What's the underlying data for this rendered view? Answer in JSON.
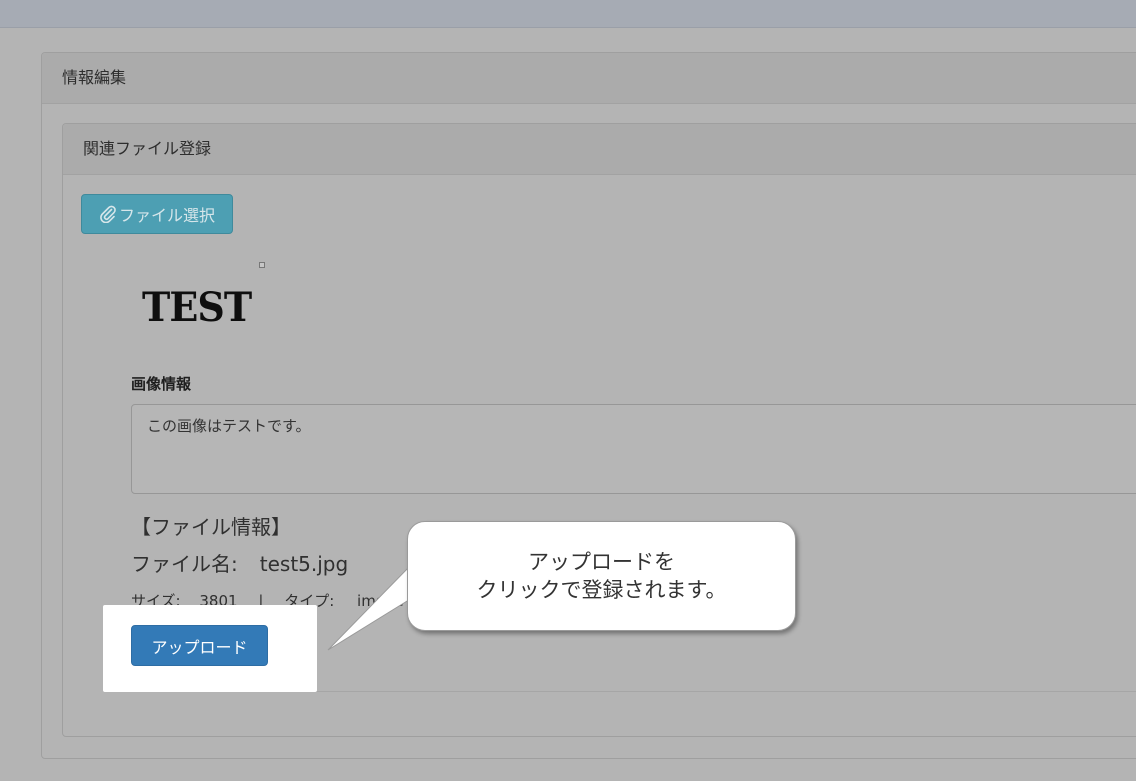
{
  "outer_panel": {
    "title": "情報編集"
  },
  "inner_panel": {
    "title": "関連ファイル登録"
  },
  "file_select_button": {
    "label": "ファイル選択",
    "icon": "paperclip-icon"
  },
  "preview": {
    "image_text": "TEST"
  },
  "image_info": {
    "label": "画像情報",
    "value": "この画像はテストです。"
  },
  "file_info": {
    "heading": "【ファイル情報】",
    "name_label": "ファイル名:",
    "name_value": "test5.jpg",
    "size_label": "サイズ:",
    "size_value": "3801",
    "separator": "|",
    "type_label": "タイプ:",
    "type_value": "image"
  },
  "upload_button": {
    "label": "アップロード"
  },
  "callout": {
    "line1": "アップロードを",
    "line2": "クリックで登録されます。"
  },
  "colors": {
    "upload_button": "#337ab7",
    "file_button": "#4d9fb3",
    "overlay": "#b4b4b4"
  }
}
